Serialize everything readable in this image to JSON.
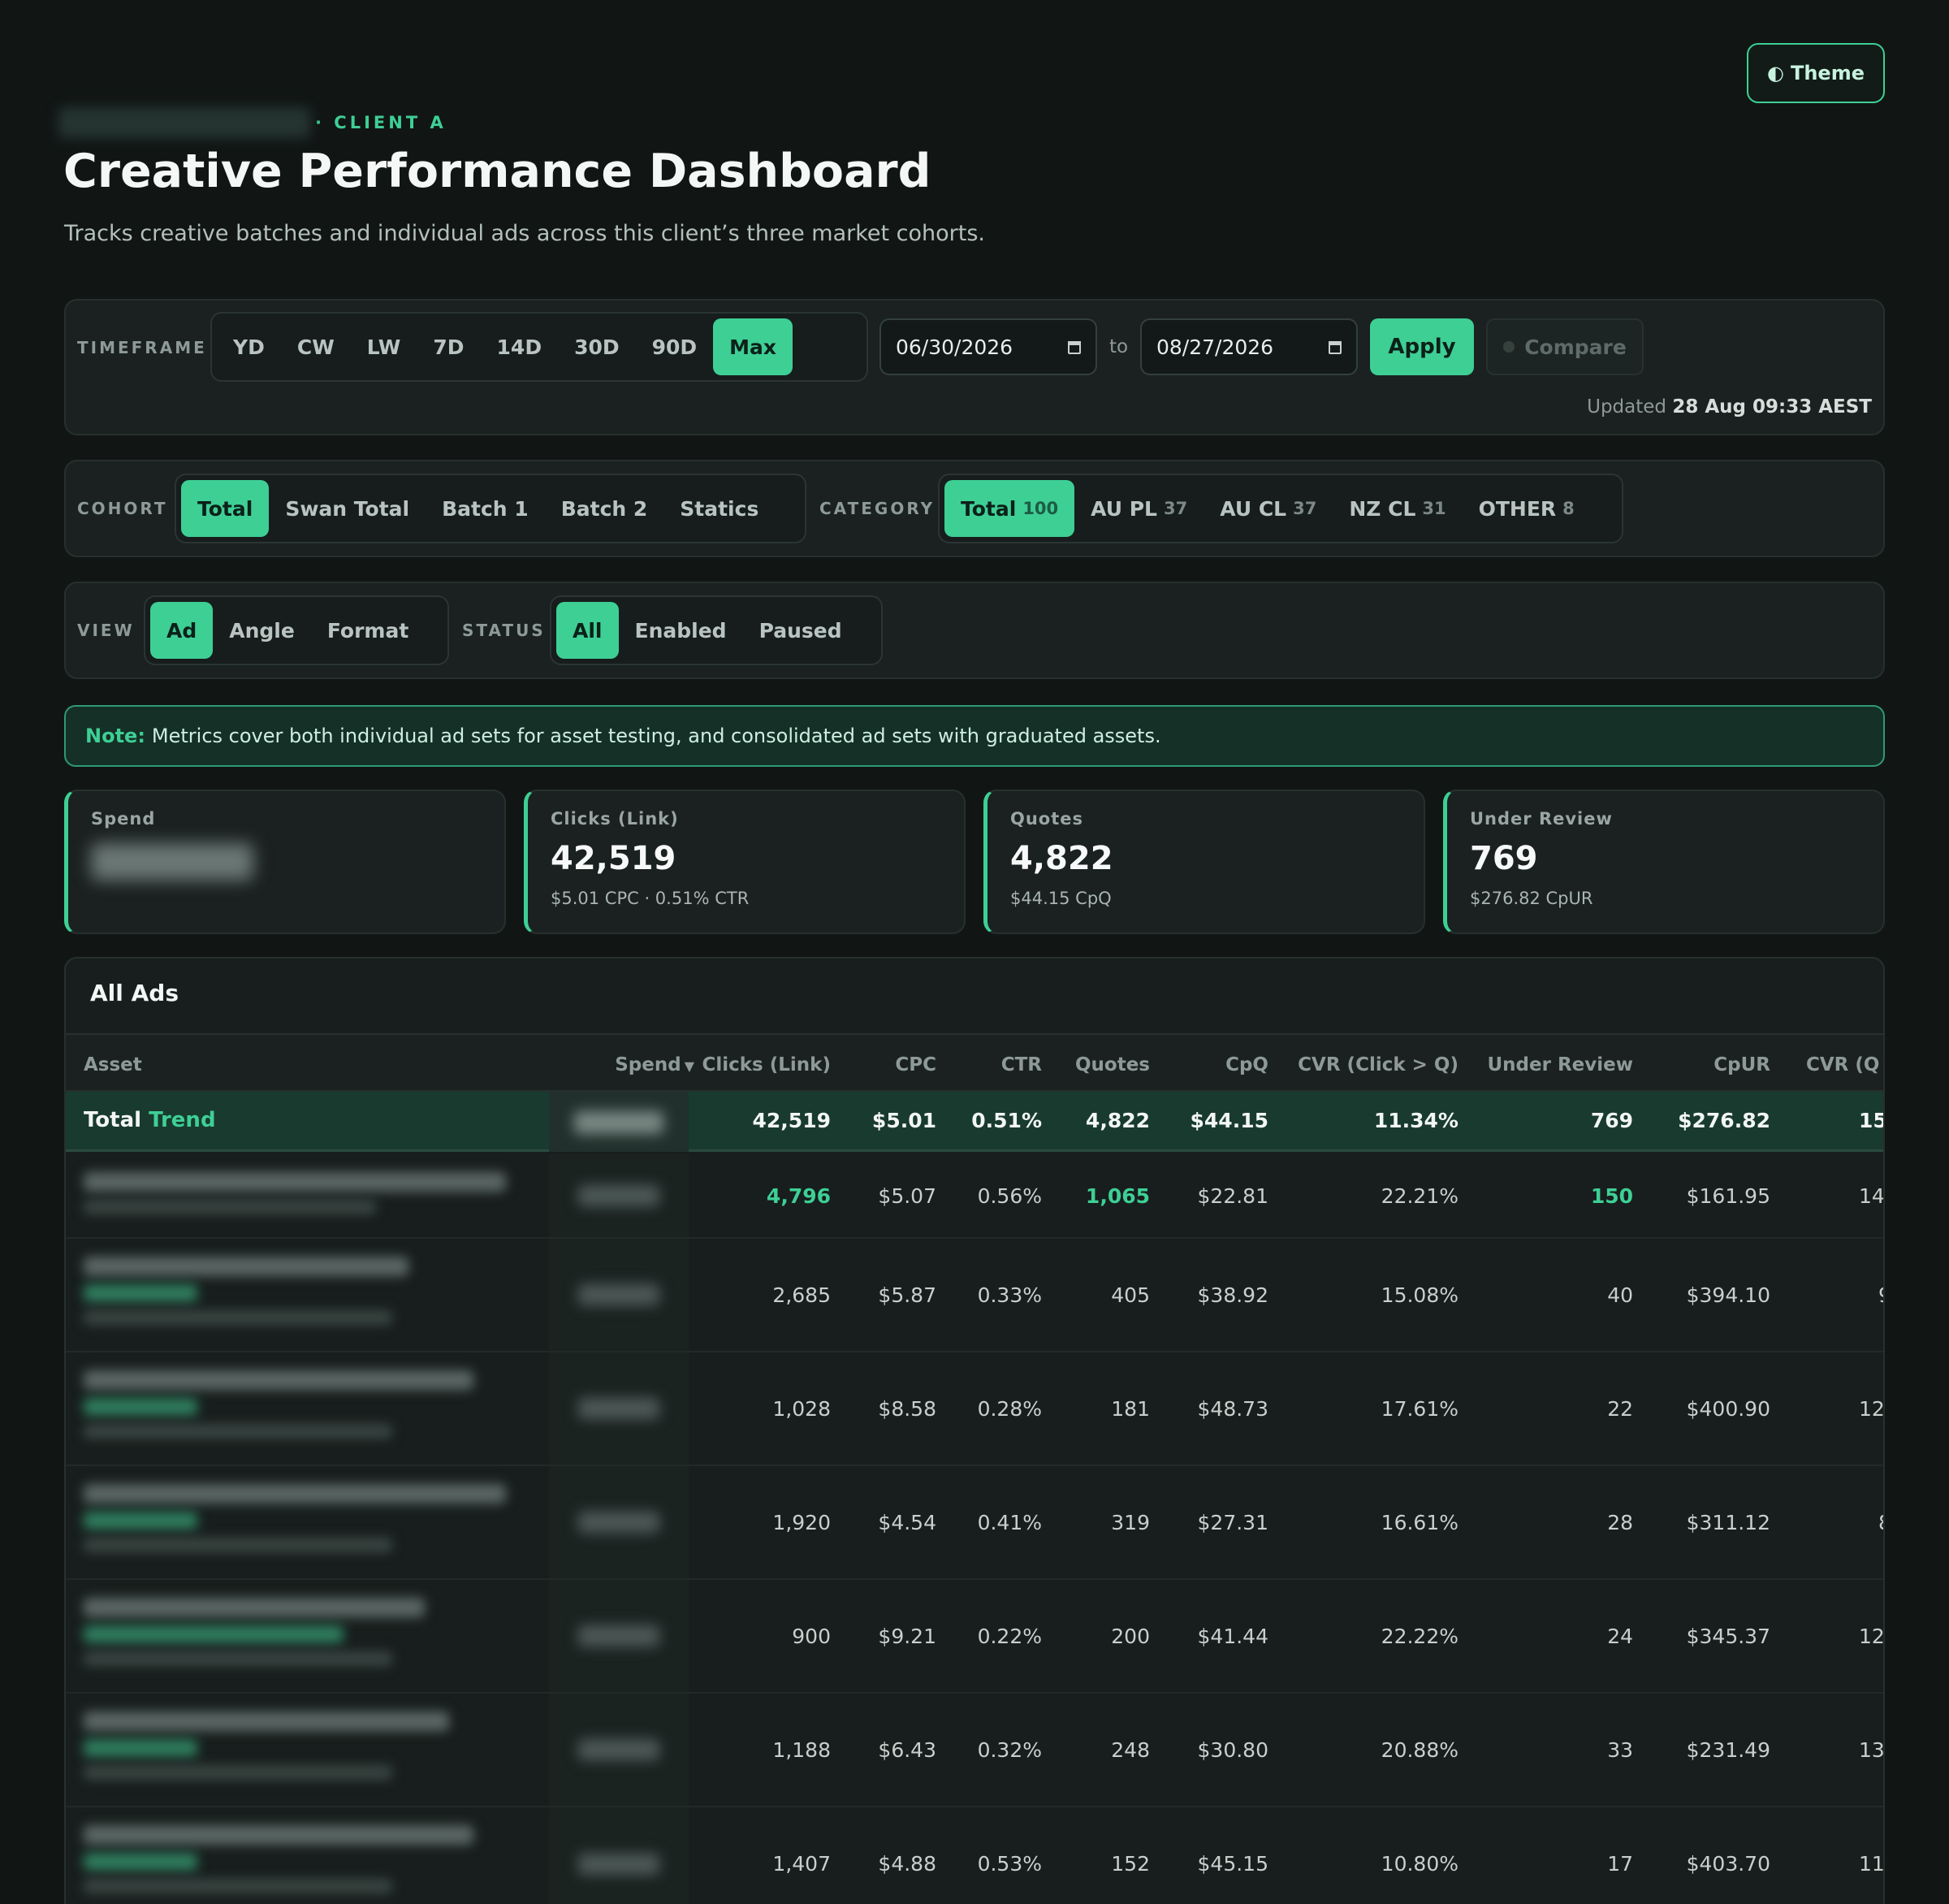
{
  "header": {
    "theme_label": "Theme",
    "eyebrow_client": "· CLIENT A",
    "title": "Creative Performance Dashboard",
    "subtitle": "Tracks creative batches and individual ads across this client’s three market cohorts."
  },
  "timeframe": {
    "label": "TIMEFRAME",
    "options": [
      "YD",
      "CW",
      "LW",
      "7D",
      "14D",
      "30D",
      "90D",
      "Max"
    ],
    "active": "Max",
    "date_from": "06/30/2026",
    "to_label": "to",
    "date_to": "08/27/2026",
    "apply_label": "Apply",
    "compare_label": "Compare",
    "updated_prefix": "Updated",
    "updated_value": "28 Aug 09:33 AEST"
  },
  "cohort": {
    "label": "COHORT",
    "options": [
      "Total",
      "Swan Total",
      "Batch 1",
      "Batch 2",
      "Statics"
    ],
    "active": "Total"
  },
  "category": {
    "label": "CATEGORY",
    "options": [
      {
        "name": "Total",
        "count": "100"
      },
      {
        "name": "AU PL",
        "count": "37"
      },
      {
        "name": "AU CL",
        "count": "37"
      },
      {
        "name": "NZ CL",
        "count": "31"
      },
      {
        "name": "OTHER",
        "count": "8"
      }
    ],
    "active": "Total"
  },
  "view": {
    "label": "VIEW",
    "options": [
      "Ad",
      "Angle",
      "Format"
    ],
    "active": "Ad"
  },
  "status": {
    "label": "STATUS",
    "options": [
      "All",
      "Enabled",
      "Paused"
    ],
    "active": "All"
  },
  "note": {
    "bold": "Note:",
    "text": "Metrics cover both individual ad sets for asset testing, and consolidated ad sets with graduated assets."
  },
  "kpis": [
    {
      "label": "Spend",
      "value": "",
      "sub": ""
    },
    {
      "label": "Clicks (Link)",
      "value": "42,519",
      "sub": "$5.01 CPC · 0.51% CTR"
    },
    {
      "label": "Quotes",
      "value": "4,822",
      "sub": "$44.15 CpQ"
    },
    {
      "label": "Under Review",
      "value": "769",
      "sub": "$276.82 CpUR"
    }
  ],
  "table": {
    "title": "All Ads",
    "columns": [
      "Asset",
      "Spend",
      "Clicks (Link)",
      "CPC",
      "CTR",
      "Quotes",
      "CpQ",
      "CVR (Click > Q)",
      "Under Review",
      "CpUR",
      "CVR (Q"
    ],
    "total_row": {
      "label_a": "Total",
      "label_b": "Trend",
      "clicks": "42,519",
      "cpc": "$5.01",
      "ctr": "0.51%",
      "quotes": "4,822",
      "cpq": "$44.15",
      "cvr": "11.34%",
      "under_review": "769",
      "cpur": "$276.82",
      "cvr_q": "15"
    },
    "rows": [
      {
        "clicks": "4,796",
        "cpc": "$5.07",
        "ctr": "0.56%",
        "quotes": "1,065",
        "cpq": "$22.81",
        "cvr": "22.21%",
        "under_review": "150",
        "cpur": "$161.95",
        "cvr_q": "14"
      },
      {
        "clicks": "2,685",
        "cpc": "$5.87",
        "ctr": "0.33%",
        "quotes": "405",
        "cpq": "$38.92",
        "cvr": "15.08%",
        "under_review": "40",
        "cpur": "$394.10",
        "cvr_q": "9"
      },
      {
        "clicks": "1,028",
        "cpc": "$8.58",
        "ctr": "0.28%",
        "quotes": "181",
        "cpq": "$48.73",
        "cvr": "17.61%",
        "under_review": "22",
        "cpur": "$400.90",
        "cvr_q": "12"
      },
      {
        "clicks": "1,920",
        "cpc": "$4.54",
        "ctr": "0.41%",
        "quotes": "319",
        "cpq": "$27.31",
        "cvr": "16.61%",
        "under_review": "28",
        "cpur": "$311.12",
        "cvr_q": "8"
      },
      {
        "clicks": "900",
        "cpc": "$9.21",
        "ctr": "0.22%",
        "quotes": "200",
        "cpq": "$41.44",
        "cvr": "22.22%",
        "under_review": "24",
        "cpur": "$345.37",
        "cvr_q": "12"
      },
      {
        "clicks": "1,188",
        "cpc": "$6.43",
        "ctr": "0.32%",
        "quotes": "248",
        "cpq": "$30.80",
        "cvr": "20.88%",
        "under_review": "33",
        "cpur": "$231.49",
        "cvr_q": "13"
      },
      {
        "clicks": "1,407",
        "cpc": "$4.88",
        "ctr": "0.53%",
        "quotes": "152",
        "cpq": "$45.15",
        "cvr": "10.80%",
        "under_review": "17",
        "cpur": "$403.70",
        "cvr_q": "11"
      }
    ]
  }
}
